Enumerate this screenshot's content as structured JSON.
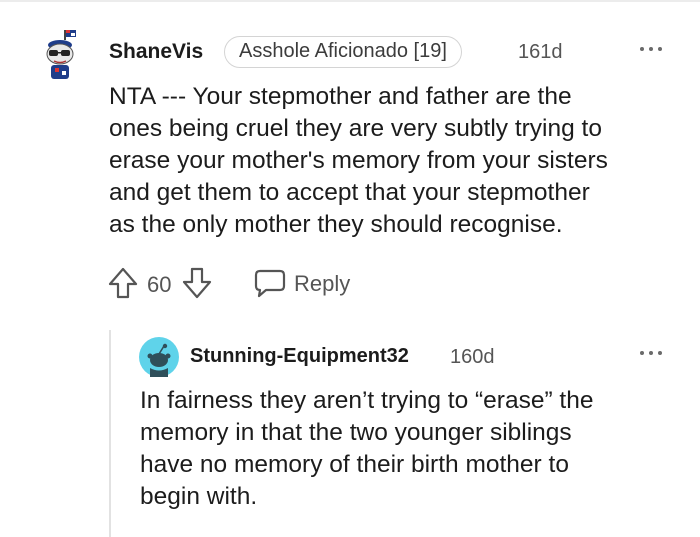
{
  "comment": {
    "username": "ShaneVis",
    "flair": "Asshole Aficionado [19]",
    "age": "161d",
    "body_lines": [
      "NTA --- Your stepmother and father are the",
      "ones being cruel they are very subtly trying to",
      "erase your mother's memory from your sisters",
      "and get them to accept that your stepmother",
      "as the only mother they should recognise."
    ],
    "score": "60",
    "reply_label": "Reply"
  },
  "reply": {
    "username": "Stunning-Equipment32",
    "age": "160d",
    "body_lines": [
      "In fairness they aren’t trying to “erase” the",
      "memory in that the two younger siblings",
      "have no memory of their birth mother to",
      "begin with."
    ]
  },
  "icons": {
    "avatar_1": "snoo-avatar-icon",
    "avatar_2": "snoo-avatar-icon",
    "more": "more-options-icon",
    "upvote": "upvote-arrow-icon",
    "downvote": "downvote-arrow-icon",
    "reply": "chat-bubble-icon"
  },
  "colors": {
    "reply_avatar_bg": "#5fd3ea",
    "thread_line": "#e2e2e2",
    "meta_text": "#555555"
  }
}
